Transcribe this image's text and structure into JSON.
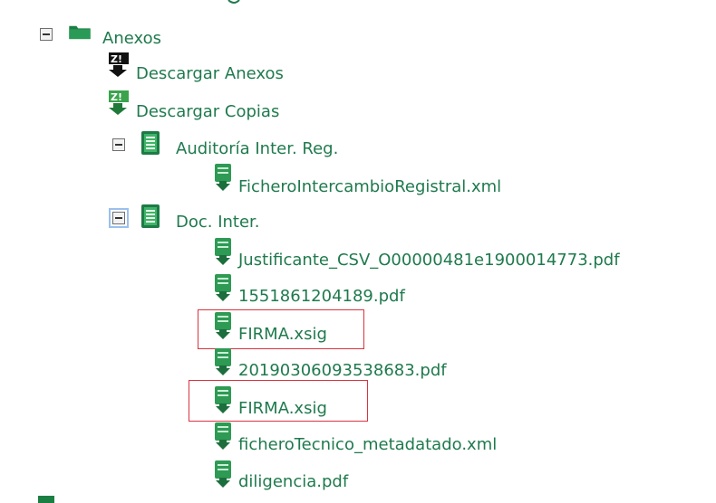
{
  "tree": {
    "root": {
      "label": "Anexos"
    },
    "actions": [
      {
        "label": "Descargar Anexos"
      },
      {
        "label": "Descargar Copias"
      }
    ],
    "groups": [
      {
        "label": "Auditoría Inter. Reg.",
        "files": [
          {
            "label": "FicheroIntercambioRegistral.xml"
          }
        ]
      },
      {
        "label": "Doc. Inter.",
        "files": [
          {
            "label": "Justificante_CSV_O00000481e1900014773.pdf"
          },
          {
            "label": "1551861204189.pdf"
          },
          {
            "label": "FIRMA.xsig",
            "highlighted": true
          },
          {
            "label": "20190306093538683.pdf"
          },
          {
            "label": "FIRMA.xsig",
            "highlighted": true
          },
          {
            "label": "ficheroTecnico_metadatado.xml"
          },
          {
            "label": "diligencia.pdf"
          }
        ]
      }
    ]
  },
  "colors": {
    "text": "#1f7a4d",
    "icon_green": "#2e9a54",
    "highlight_border": "#d9343f"
  },
  "icons": {
    "collapse": "minus-box-icon",
    "folder": "folder-icon",
    "zip_download": "zip-download-icon",
    "zip_copy": "zip-download-green-icon",
    "document_group": "document-stack-icon",
    "file_download": "file-download-icon"
  }
}
